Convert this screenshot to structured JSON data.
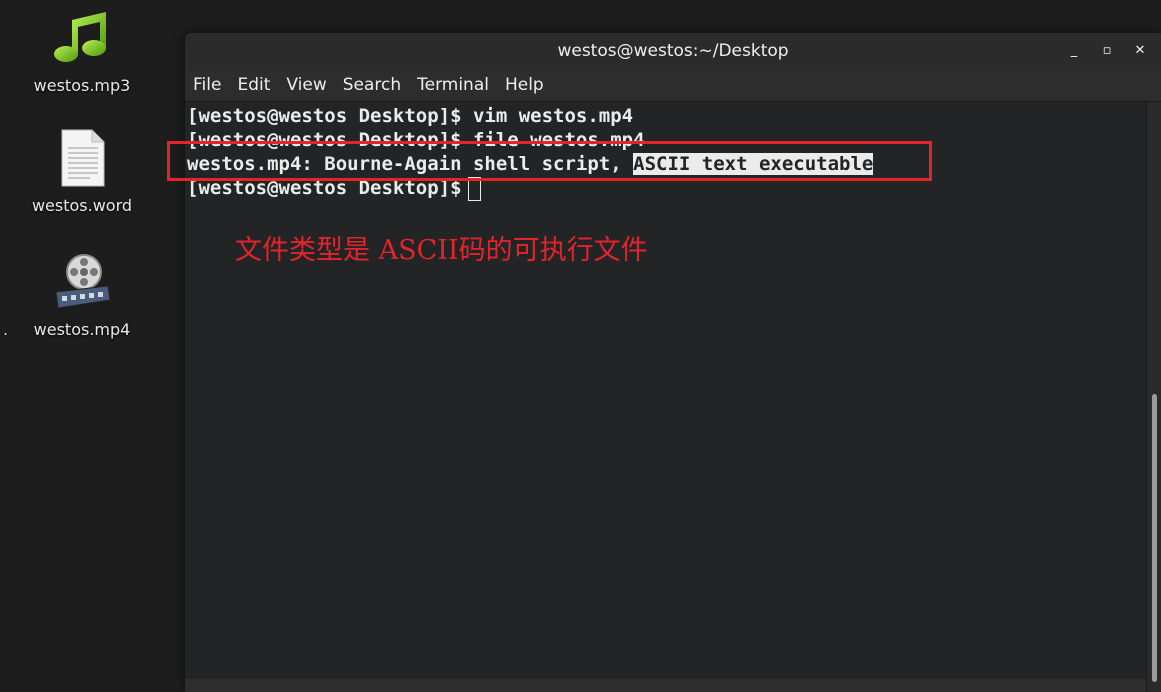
{
  "desktop": {
    "icons": [
      {
        "label": "westos.mp3",
        "icon": "music-note-icon"
      },
      {
        "label": "westos.word",
        "icon": "text-document-icon"
      },
      {
        "label": "westos.mp4",
        "icon": "film-reel-icon"
      }
    ],
    "stray_text": "."
  },
  "window": {
    "title": "westos@westos:~/Desktop",
    "controls": {
      "minimize": "_",
      "maximize": "▫",
      "close": "✕"
    },
    "menu": [
      "File",
      "Edit",
      "View",
      "Search",
      "Terminal",
      "Help"
    ]
  },
  "terminal": {
    "lines": [
      {
        "text": "[westos@westos Desktop]$ vim westos.mp4"
      },
      {
        "text": "[westos@westos Desktop]$ file westos.mp4"
      },
      {
        "text": "westos.mp4: Bourne-Again shell script, ",
        "highlight": "ASCII text executable"
      },
      {
        "text": "[westos@westos Desktop]$"
      }
    ]
  },
  "annotation": {
    "text": "文件类型是 ASCII码的可执行文件",
    "color": "#e3242b"
  },
  "colors": {
    "terminal_bg": "#222426",
    "terminal_fg": "#ebebeb",
    "annotation_red": "#e3242b"
  }
}
